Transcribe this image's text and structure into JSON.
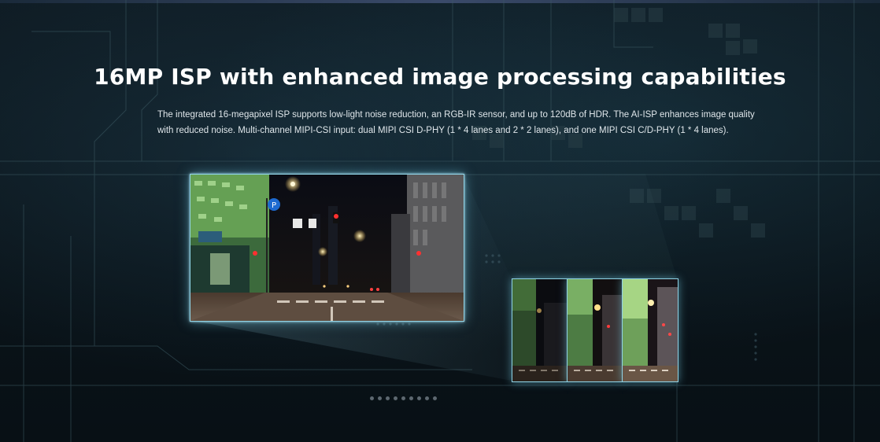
{
  "heading": {
    "title": "16MP ISP with enhanced image processing capabilities"
  },
  "description": {
    "line1": "The integrated 16-megapixel ISP supports low-light noise reduction, an RGB-IR sensor, and up to 120dB of HDR. The AI-ISP enhances image quality",
    "line2": "with reduced noise. Multi-channel MIPI-CSI input: dual MIPI CSI D-PHY (1 * 4 lanes and 2 * 2 lanes), and one MIPI CSI C/D-PHY (1 * 4 lanes)."
  },
  "main_image": {
    "icon": "night-street-scene-photo",
    "parking_sign": "P"
  },
  "thumbnails": [
    {
      "icon": "night-street-thumbnail-dark"
    },
    {
      "icon": "night-street-thumbnail-medium"
    },
    {
      "icon": "night-street-thumbnail-bright"
    }
  ],
  "pagination": {
    "count": 9,
    "active_index": 0
  },
  "colors": {
    "accent_glow": "#8fd3e6",
    "background": "#0b141a",
    "text": "#ffffff"
  }
}
